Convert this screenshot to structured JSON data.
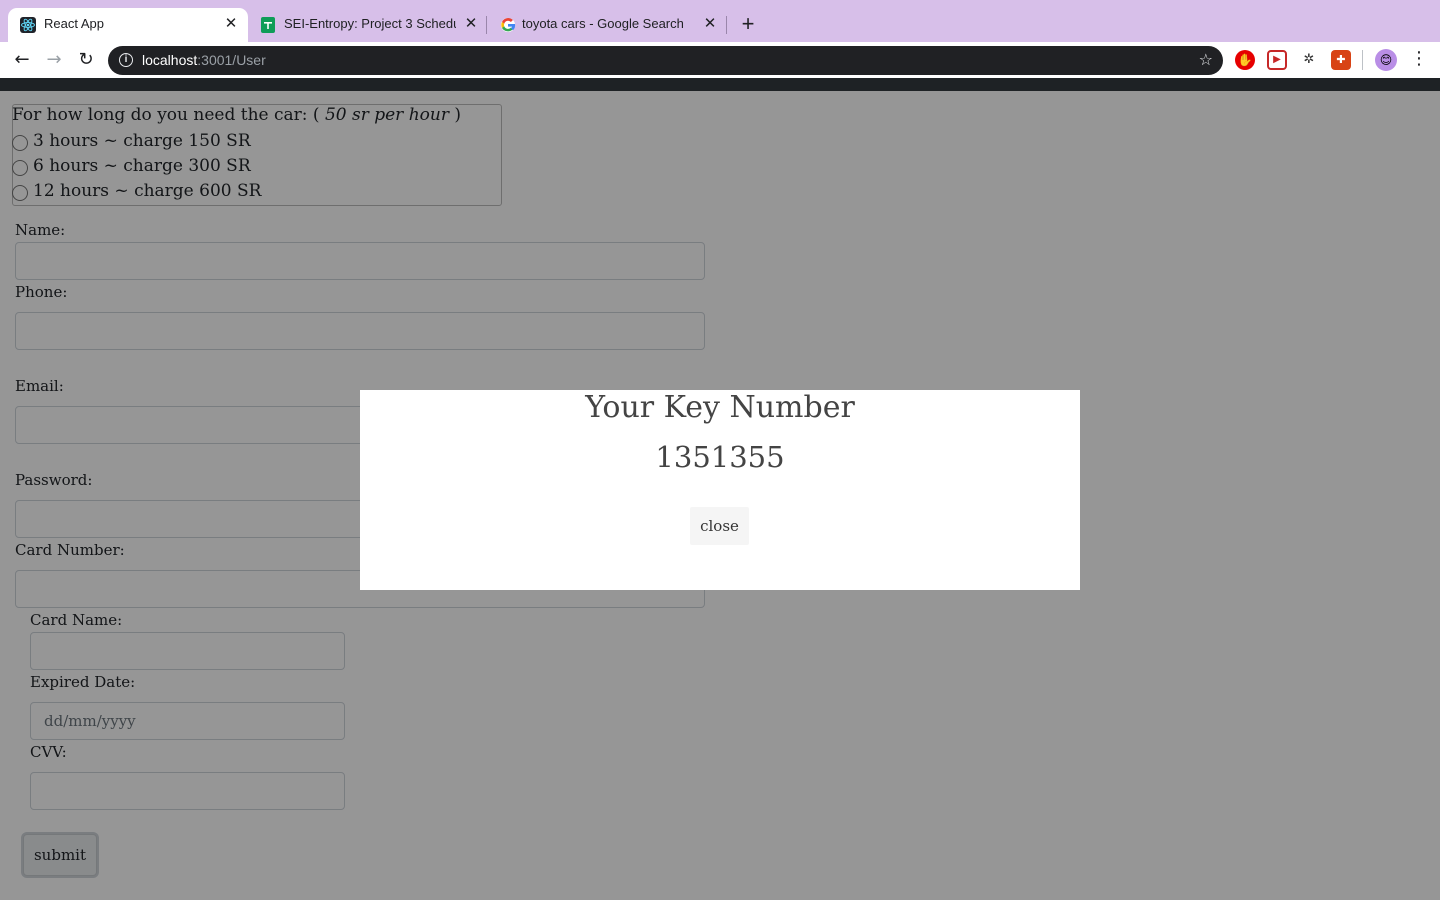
{
  "browser": {
    "tabs": [
      {
        "title": "React App",
        "icon": "react-icon"
      },
      {
        "title": "SEI-Entropy: Project 3 Schedule",
        "icon": "sheets-icon"
      },
      {
        "title": "toyota cars - Google Search",
        "icon": "google-icon"
      }
    ],
    "url_host": "localhost",
    "url_path": ":3001/User",
    "colors": {
      "tabstrip": "#d7bfe9",
      "omnibox": "#202124"
    }
  },
  "form": {
    "duration_legend": "For how long do you need the car: (",
    "duration_rate": "50 sr per hour",
    "duration_legend_end": ")",
    "options": [
      "3 hours ~ charge 150 SR",
      "6 hours ~ charge 300 SR",
      "12 hours ~ charge 600 SR"
    ],
    "name_label": "Name:",
    "phone_label": "Phone:",
    "email_label": "Email:",
    "password_label": "Password:",
    "card_number_label": "Card Number:",
    "card_name_label": "Card Name:",
    "expired_date_label": "Expired Date:",
    "expired_date_placeholder": "dd/mm/yyyy",
    "cvv_label": "CVV:",
    "submit_label": "submit"
  },
  "modal": {
    "title": "Your Key Number",
    "key_number": "1351355",
    "close_label": "close"
  }
}
